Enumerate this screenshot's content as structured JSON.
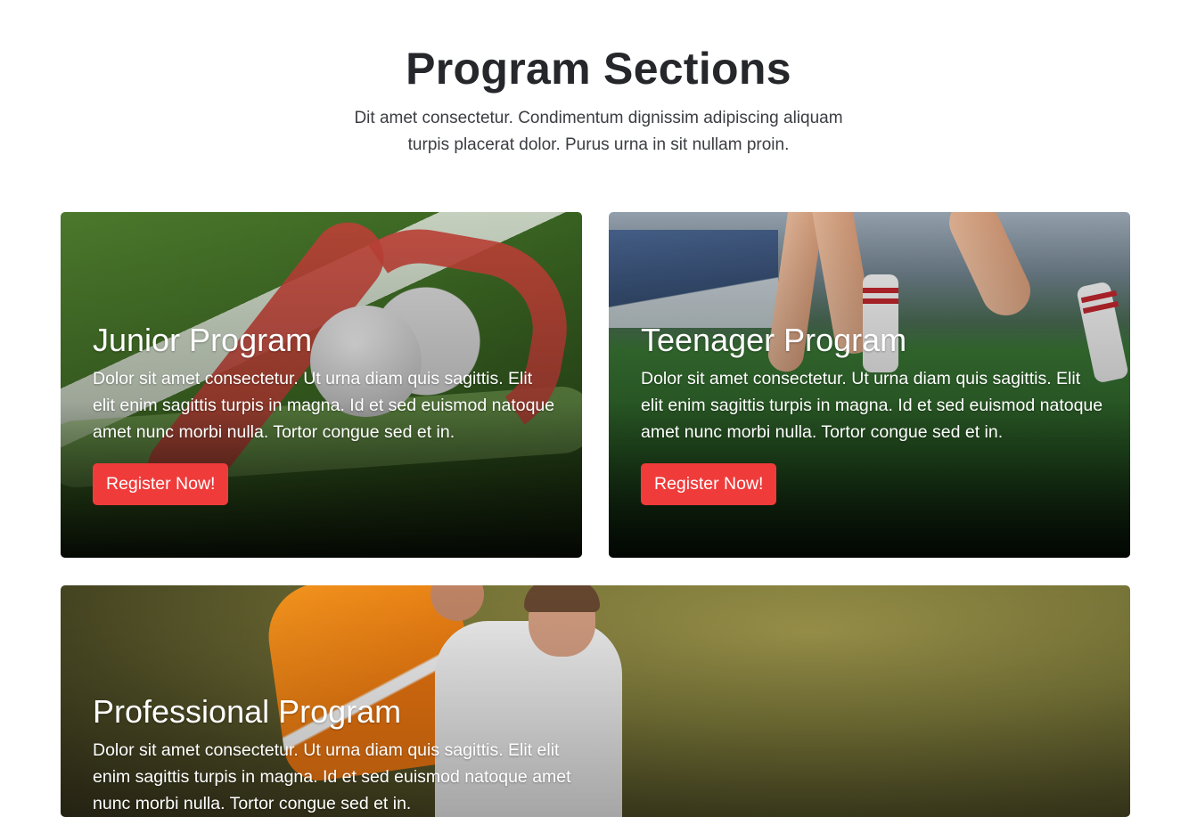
{
  "header": {
    "title": "Program Sections",
    "subtitle": "Dit amet consectetur. Condimentum dignissim adipiscing aliquam turpis placerat dolor. Purus urna in sit nullam proin."
  },
  "programs": [
    {
      "title": "Junior Program",
      "description": "Dolor sit amet consectetur. Ut urna diam quis sagittis. Elit elit enim sagittis turpis in magna. Id et sed euismod natoque amet nunc morbi nulla. Tortor congue sed et in.",
      "button_label": "Register Now!"
    },
    {
      "title": "Teenager Program",
      "description": "Dolor sit amet consectetur. Ut urna diam quis sagittis. Elit elit enim sagittis turpis in magna. Id et sed euismod natoque amet nunc morbi nulla. Tortor congue sed et in.",
      "button_label": "Register Now!"
    },
    {
      "title": "Professional Program",
      "description": "Dolor sit amet consectetur. Ut urna diam quis sagittis. Elit elit enim sagittis turpis in magna. Id et sed euismod natoque amet nunc morbi nulla. Tortor congue sed et in."
    }
  ],
  "colors": {
    "accent": "#f03b3b",
    "heading": "#25272b"
  }
}
